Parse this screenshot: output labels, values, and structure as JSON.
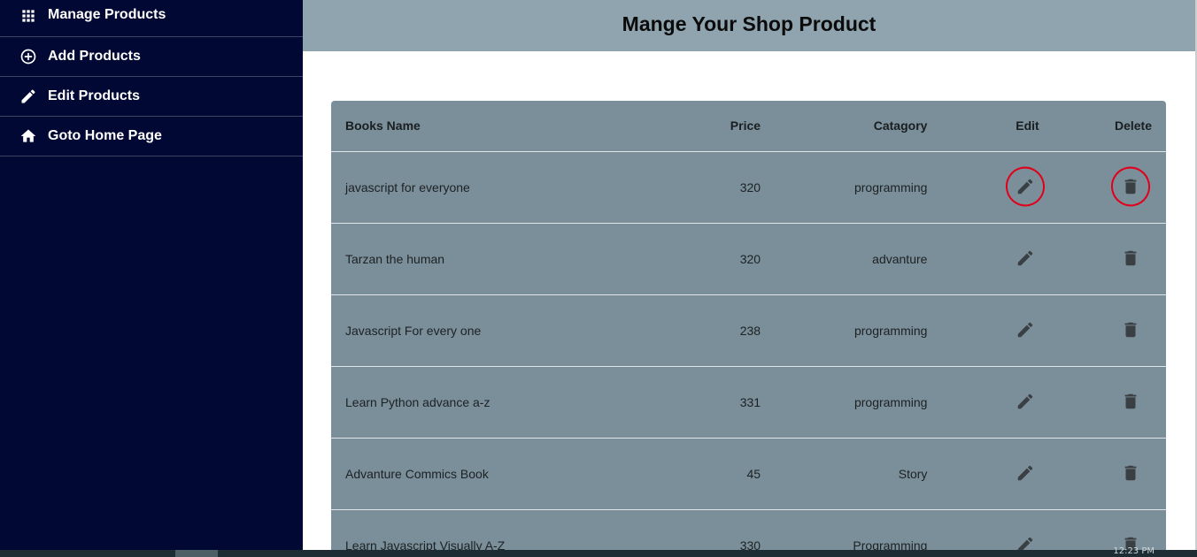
{
  "sidebar": {
    "items": [
      {
        "label": "Manage Products",
        "icon": "grid-icon"
      },
      {
        "label": "Add Products",
        "icon": "add-circle-icon"
      },
      {
        "label": "Edit Products",
        "icon": "pencil-icon"
      },
      {
        "label": "Goto Home Page",
        "icon": "home-icon"
      }
    ]
  },
  "header": {
    "title": "Mange Your Shop Product"
  },
  "table": {
    "columns": [
      "Books Name",
      "Price",
      "Catagory",
      "Edit",
      "Delete"
    ],
    "rows": [
      {
        "name": "javascript for everyone",
        "price": "320",
        "category": "programming"
      },
      {
        "name": "Tarzan the human",
        "price": "320",
        "category": "advanture"
      },
      {
        "name": "Javascript For every one",
        "price": "238",
        "category": "programming"
      },
      {
        "name": "Learn Python advance a-z",
        "price": "331",
        "category": "programming"
      },
      {
        "name": "Advanture Commics Book",
        "price": "45",
        "category": "Story"
      },
      {
        "name": "Learn Javascript Visually A-Z",
        "price": "330",
        "category": "Programming"
      }
    ]
  },
  "colors": {
    "sidebar_bg": "#010833",
    "header_bg": "#8fa4ae",
    "table_bg": "#7a8f99",
    "annotation": "#e0001b"
  },
  "taskbar": {
    "clock": "12:23 PM"
  }
}
